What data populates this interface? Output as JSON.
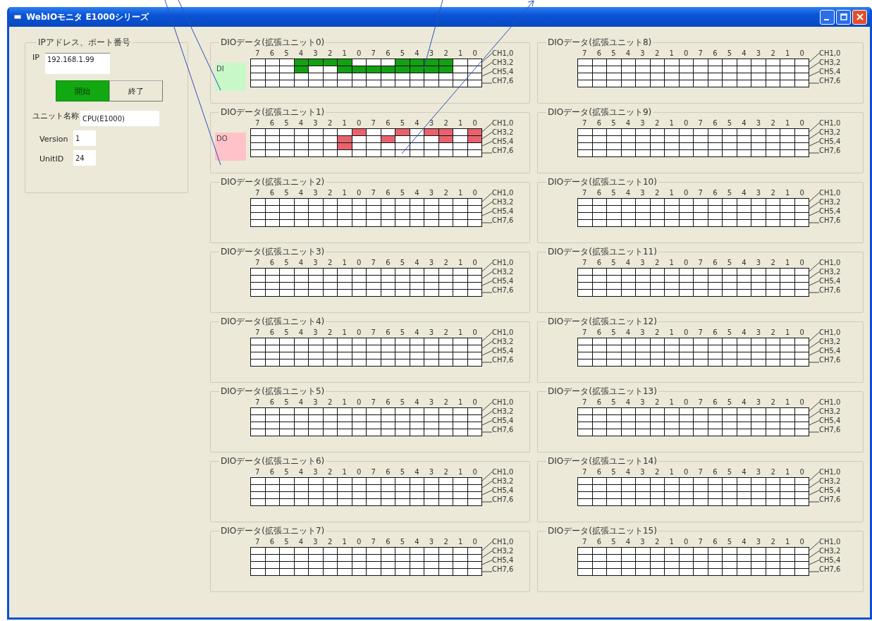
{
  "window": {
    "title": "WebIOモニタ E1000シリーズ"
  },
  "connection": {
    "title": "IPアドレス、ポート番号",
    "ip_label": "IP",
    "ip": "192.168.1.99",
    "buttons": [
      {
        "label": "開始",
        "on": true
      },
      {
        "label": "終了",
        "on": false
      }
    ],
    "unit_name_label": "ユニット名称",
    "unit_name": "CPU(E1000)",
    "version_label": "Version",
    "version": "1",
    "unitid_label": "UnitID",
    "unitid": "24"
  },
  "units": [
    {
      "title": "DIOデータ(拡張ユニット0)",
      "kind": "input",
      "indicator": "DI",
      "bits": [
        "7",
        "6",
        "5",
        "4",
        "3",
        "2",
        "1",
        "0",
        "7",
        "6",
        "5",
        "4",
        "3",
        "2",
        "1",
        "0"
      ],
      "rows": [
        {
          "label": "CH1,0",
          "cells": [
            false,
            false,
            false,
            true,
            true,
            true,
            true,
            false,
            false,
            false,
            true,
            true,
            true,
            true,
            false,
            false
          ]
        },
        {
          "label": "CH3,2",
          "cells": [
            false,
            false,
            false,
            true,
            false,
            false,
            true,
            true,
            true,
            true,
            true,
            true,
            true,
            true,
            false,
            false
          ]
        },
        {
          "label": "CH5,4",
          "cells": [
            false,
            false,
            false,
            false,
            false,
            false,
            false,
            false,
            false,
            false,
            false,
            false,
            false,
            false,
            false,
            false
          ]
        },
        {
          "label": "CH7,6",
          "cells": [
            false,
            false,
            false,
            false,
            false,
            false,
            false,
            false,
            false,
            false,
            false,
            false,
            false,
            false,
            false,
            false
          ]
        }
      ]
    },
    {
      "title": "DIOデータ(拡張ユニット1)",
      "kind": "output",
      "indicator": "DO",
      "bits": [
        "7",
        "6",
        "5",
        "4",
        "3",
        "2",
        "1",
        "0",
        "7",
        "6",
        "5",
        "4",
        "3",
        "2",
        "1",
        "0"
      ],
      "rows": [
        {
          "label": "CH1,0",
          "cells": [
            false,
            false,
            false,
            false,
            false,
            false,
            false,
            true,
            false,
            false,
            true,
            false,
            true,
            true,
            false,
            true
          ]
        },
        {
          "label": "CH3,2",
          "cells": [
            false,
            false,
            false,
            false,
            false,
            false,
            true,
            false,
            false,
            true,
            false,
            false,
            false,
            true,
            false,
            true
          ]
        },
        {
          "label": "CH5,4",
          "cells": [
            false,
            false,
            false,
            false,
            false,
            false,
            true,
            false,
            false,
            false,
            false,
            false,
            false,
            false,
            false,
            false
          ]
        },
        {
          "label": "CH7,6",
          "cells": [
            false,
            false,
            false,
            false,
            false,
            false,
            false,
            false,
            false,
            false,
            false,
            false,
            false,
            false,
            false,
            false
          ]
        }
      ]
    },
    {
      "title": "DIOデータ(拡張ユニット2)",
      "kind": "none",
      "bits": [
        "7",
        "6",
        "5",
        "4",
        "3",
        "2",
        "1",
        "0",
        "7",
        "6",
        "5",
        "4",
        "3",
        "2",
        "1",
        "0"
      ],
      "rows": [
        {
          "label": "CH1,0",
          "cells": [
            false,
            false,
            false,
            false,
            false,
            false,
            false,
            false,
            false,
            false,
            false,
            false,
            false,
            false,
            false,
            false
          ]
        },
        {
          "label": "CH3,2",
          "cells": [
            false,
            false,
            false,
            false,
            false,
            false,
            false,
            false,
            false,
            false,
            false,
            false,
            false,
            false,
            false,
            false
          ]
        },
        {
          "label": "CH5,4",
          "cells": [
            false,
            false,
            false,
            false,
            false,
            false,
            false,
            false,
            false,
            false,
            false,
            false,
            false,
            false,
            false,
            false
          ]
        },
        {
          "label": "CH7,6",
          "cells": [
            false,
            false,
            false,
            false,
            false,
            false,
            false,
            false,
            false,
            false,
            false,
            false,
            false,
            false,
            false,
            false
          ]
        }
      ]
    },
    {
      "title": "DIOデータ(拡張ユニット3)",
      "kind": "none",
      "bits": [
        "7",
        "6",
        "5",
        "4",
        "3",
        "2",
        "1",
        "0",
        "7",
        "6",
        "5",
        "4",
        "3",
        "2",
        "1",
        "0"
      ],
      "rows": [
        {
          "label": "CH1,0",
          "cells": [
            false,
            false,
            false,
            false,
            false,
            false,
            false,
            false,
            false,
            false,
            false,
            false,
            false,
            false,
            false,
            false
          ]
        },
        {
          "label": "CH3,2",
          "cells": [
            false,
            false,
            false,
            false,
            false,
            false,
            false,
            false,
            false,
            false,
            false,
            false,
            false,
            false,
            false,
            false
          ]
        },
        {
          "label": "CH5,4",
          "cells": [
            false,
            false,
            false,
            false,
            false,
            false,
            false,
            false,
            false,
            false,
            false,
            false,
            false,
            false,
            false,
            false
          ]
        },
        {
          "label": "CH7,6",
          "cells": [
            false,
            false,
            false,
            false,
            false,
            false,
            false,
            false,
            false,
            false,
            false,
            false,
            false,
            false,
            false,
            false
          ]
        }
      ]
    },
    {
      "title": "DIOデータ(拡張ユニット4)",
      "kind": "none",
      "bits": [
        "7",
        "6",
        "5",
        "4",
        "3",
        "2",
        "1",
        "0",
        "7",
        "6",
        "5",
        "4",
        "3",
        "2",
        "1",
        "0"
      ],
      "rows": [
        {
          "label": "CH1,0",
          "cells": [
            false,
            false,
            false,
            false,
            false,
            false,
            false,
            false,
            false,
            false,
            false,
            false,
            false,
            false,
            false,
            false
          ]
        },
        {
          "label": "CH3,2",
          "cells": [
            false,
            false,
            false,
            false,
            false,
            false,
            false,
            false,
            false,
            false,
            false,
            false,
            false,
            false,
            false,
            false
          ]
        },
        {
          "label": "CH5,4",
          "cells": [
            false,
            false,
            false,
            false,
            false,
            false,
            false,
            false,
            false,
            false,
            false,
            false,
            false,
            false,
            false,
            false
          ]
        },
        {
          "label": "CH7,6",
          "cells": [
            false,
            false,
            false,
            false,
            false,
            false,
            false,
            false,
            false,
            false,
            false,
            false,
            false,
            false,
            false,
            false
          ]
        }
      ]
    },
    {
      "title": "DIOデータ(拡張ユニット5)",
      "kind": "none",
      "bits": [
        "7",
        "6",
        "5",
        "4",
        "3",
        "2",
        "1",
        "0",
        "7",
        "6",
        "5",
        "4",
        "3",
        "2",
        "1",
        "0"
      ],
      "rows": [
        {
          "label": "CH1,0",
          "cells": [
            false,
            false,
            false,
            false,
            false,
            false,
            false,
            false,
            false,
            false,
            false,
            false,
            false,
            false,
            false,
            false
          ]
        },
        {
          "label": "CH3,2",
          "cells": [
            false,
            false,
            false,
            false,
            false,
            false,
            false,
            false,
            false,
            false,
            false,
            false,
            false,
            false,
            false,
            false
          ]
        },
        {
          "label": "CH5,4",
          "cells": [
            false,
            false,
            false,
            false,
            false,
            false,
            false,
            false,
            false,
            false,
            false,
            false,
            false,
            false,
            false,
            false
          ]
        },
        {
          "label": "CH7,6",
          "cells": [
            false,
            false,
            false,
            false,
            false,
            false,
            false,
            false,
            false,
            false,
            false,
            false,
            false,
            false,
            false,
            false
          ]
        }
      ]
    },
    {
      "title": "DIOデータ(拡張ユニット6)",
      "kind": "none",
      "bits": [
        "7",
        "6",
        "5",
        "4",
        "3",
        "2",
        "1",
        "0",
        "7",
        "6",
        "5",
        "4",
        "3",
        "2",
        "1",
        "0"
      ],
      "rows": [
        {
          "label": "CH1,0",
          "cells": [
            false,
            false,
            false,
            false,
            false,
            false,
            false,
            false,
            false,
            false,
            false,
            false,
            false,
            false,
            false,
            false
          ]
        },
        {
          "label": "CH3,2",
          "cells": [
            false,
            false,
            false,
            false,
            false,
            false,
            false,
            false,
            false,
            false,
            false,
            false,
            false,
            false,
            false,
            false
          ]
        },
        {
          "label": "CH5,4",
          "cells": [
            false,
            false,
            false,
            false,
            false,
            false,
            false,
            false,
            false,
            false,
            false,
            false,
            false,
            false,
            false,
            false
          ]
        },
        {
          "label": "CH7,6",
          "cells": [
            false,
            false,
            false,
            false,
            false,
            false,
            false,
            false,
            false,
            false,
            false,
            false,
            false,
            false,
            false,
            false
          ]
        }
      ]
    },
    {
      "title": "DIOデータ(拡張ユニット7)",
      "kind": "none",
      "bits": [
        "7",
        "6",
        "5",
        "4",
        "3",
        "2",
        "1",
        "0",
        "7",
        "6",
        "5",
        "4",
        "3",
        "2",
        "1",
        "0"
      ],
      "rows": [
        {
          "label": "CH1,0",
          "cells": [
            false,
            false,
            false,
            false,
            false,
            false,
            false,
            false,
            false,
            false,
            false,
            false,
            false,
            false,
            false,
            false
          ]
        },
        {
          "label": "CH3,2",
          "cells": [
            false,
            false,
            false,
            false,
            false,
            false,
            false,
            false,
            false,
            false,
            false,
            false,
            false,
            false,
            false,
            false
          ]
        },
        {
          "label": "CH5,4",
          "cells": [
            false,
            false,
            false,
            false,
            false,
            false,
            false,
            false,
            false,
            false,
            false,
            false,
            false,
            false,
            false,
            false
          ]
        },
        {
          "label": "CH7,6",
          "cells": [
            false,
            false,
            false,
            false,
            false,
            false,
            false,
            false,
            false,
            false,
            false,
            false,
            false,
            false,
            false,
            false
          ]
        }
      ]
    },
    {
      "title": "DIOデータ(拡張ユニット8)",
      "kind": "none",
      "bits": [
        "7",
        "6",
        "5",
        "4",
        "3",
        "2",
        "1",
        "0",
        "7",
        "6",
        "5",
        "4",
        "3",
        "2",
        "1",
        "0"
      ],
      "rows": [
        {
          "label": "CH1,0",
          "cells": [
            false,
            false,
            false,
            false,
            false,
            false,
            false,
            false,
            false,
            false,
            false,
            false,
            false,
            false,
            false,
            false
          ]
        },
        {
          "label": "CH3,2",
          "cells": [
            false,
            false,
            false,
            false,
            false,
            false,
            false,
            false,
            false,
            false,
            false,
            false,
            false,
            false,
            false,
            false
          ]
        },
        {
          "label": "CH5,4",
          "cells": [
            false,
            false,
            false,
            false,
            false,
            false,
            false,
            false,
            false,
            false,
            false,
            false,
            false,
            false,
            false,
            false
          ]
        },
        {
          "label": "CH7,6",
          "cells": [
            false,
            false,
            false,
            false,
            false,
            false,
            false,
            false,
            false,
            false,
            false,
            false,
            false,
            false,
            false,
            false
          ]
        }
      ]
    },
    {
      "title": "DIOデータ(拡張ユニット9)",
      "kind": "none",
      "bits": [
        "7",
        "6",
        "5",
        "4",
        "3",
        "2",
        "1",
        "0",
        "7",
        "6",
        "5",
        "4",
        "3",
        "2",
        "1",
        "0"
      ],
      "rows": [
        {
          "label": "CH1,0",
          "cells": [
            false,
            false,
            false,
            false,
            false,
            false,
            false,
            false,
            false,
            false,
            false,
            false,
            false,
            false,
            false,
            false
          ]
        },
        {
          "label": "CH3,2",
          "cells": [
            false,
            false,
            false,
            false,
            false,
            false,
            false,
            false,
            false,
            false,
            false,
            false,
            false,
            false,
            false,
            false
          ]
        },
        {
          "label": "CH5,4",
          "cells": [
            false,
            false,
            false,
            false,
            false,
            false,
            false,
            false,
            false,
            false,
            false,
            false,
            false,
            false,
            false,
            false
          ]
        },
        {
          "label": "CH7,6",
          "cells": [
            false,
            false,
            false,
            false,
            false,
            false,
            false,
            false,
            false,
            false,
            false,
            false,
            false,
            false,
            false,
            false
          ]
        }
      ]
    },
    {
      "title": "DIOデータ(拡張ユニット10)",
      "kind": "none",
      "bits": [
        "7",
        "6",
        "5",
        "4",
        "3",
        "2",
        "1",
        "0",
        "7",
        "6",
        "5",
        "4",
        "3",
        "2",
        "1",
        "0"
      ],
      "rows": [
        {
          "label": "CH1,0",
          "cells": [
            false,
            false,
            false,
            false,
            false,
            false,
            false,
            false,
            false,
            false,
            false,
            false,
            false,
            false,
            false,
            false
          ]
        },
        {
          "label": "CH3,2",
          "cells": [
            false,
            false,
            false,
            false,
            false,
            false,
            false,
            false,
            false,
            false,
            false,
            false,
            false,
            false,
            false,
            false
          ]
        },
        {
          "label": "CH5,4",
          "cells": [
            false,
            false,
            false,
            false,
            false,
            false,
            false,
            false,
            false,
            false,
            false,
            false,
            false,
            false,
            false,
            false
          ]
        },
        {
          "label": "CH7,6",
          "cells": [
            false,
            false,
            false,
            false,
            false,
            false,
            false,
            false,
            false,
            false,
            false,
            false,
            false,
            false,
            false,
            false
          ]
        }
      ]
    },
    {
      "title": "DIOデータ(拡張ユニット11)",
      "kind": "none",
      "bits": [
        "7",
        "6",
        "5",
        "4",
        "3",
        "2",
        "1",
        "0",
        "7",
        "6",
        "5",
        "4",
        "3",
        "2",
        "1",
        "0"
      ],
      "rows": [
        {
          "label": "CH1,0",
          "cells": [
            false,
            false,
            false,
            false,
            false,
            false,
            false,
            false,
            false,
            false,
            false,
            false,
            false,
            false,
            false,
            false
          ]
        },
        {
          "label": "CH3,2",
          "cells": [
            false,
            false,
            false,
            false,
            false,
            false,
            false,
            false,
            false,
            false,
            false,
            false,
            false,
            false,
            false,
            false
          ]
        },
        {
          "label": "CH5,4",
          "cells": [
            false,
            false,
            false,
            false,
            false,
            false,
            false,
            false,
            false,
            false,
            false,
            false,
            false,
            false,
            false,
            false
          ]
        },
        {
          "label": "CH7,6",
          "cells": [
            false,
            false,
            false,
            false,
            false,
            false,
            false,
            false,
            false,
            false,
            false,
            false,
            false,
            false,
            false,
            false
          ]
        }
      ]
    },
    {
      "title": "DIOデータ(拡張ユニット12)",
      "kind": "none",
      "bits": [
        "7",
        "6",
        "5",
        "4",
        "3",
        "2",
        "1",
        "0",
        "7",
        "6",
        "5",
        "4",
        "3",
        "2",
        "1",
        "0"
      ],
      "rows": [
        {
          "label": "CH1,0",
          "cells": [
            false,
            false,
            false,
            false,
            false,
            false,
            false,
            false,
            false,
            false,
            false,
            false,
            false,
            false,
            false,
            false
          ]
        },
        {
          "label": "CH3,2",
          "cells": [
            false,
            false,
            false,
            false,
            false,
            false,
            false,
            false,
            false,
            false,
            false,
            false,
            false,
            false,
            false,
            false
          ]
        },
        {
          "label": "CH5,4",
          "cells": [
            false,
            false,
            false,
            false,
            false,
            false,
            false,
            false,
            false,
            false,
            false,
            false,
            false,
            false,
            false,
            false
          ]
        },
        {
          "label": "CH7,6",
          "cells": [
            false,
            false,
            false,
            false,
            false,
            false,
            false,
            false,
            false,
            false,
            false,
            false,
            false,
            false,
            false,
            false
          ]
        }
      ]
    },
    {
      "title": "DIOデータ(拡張ユニット13)",
      "kind": "none",
      "bits": [
        "7",
        "6",
        "5",
        "4",
        "3",
        "2",
        "1",
        "0",
        "7",
        "6",
        "5",
        "4",
        "3",
        "2",
        "1",
        "0"
      ],
      "rows": [
        {
          "label": "CH1,0",
          "cells": [
            false,
            false,
            false,
            false,
            false,
            false,
            false,
            false,
            false,
            false,
            false,
            false,
            false,
            false,
            false,
            false
          ]
        },
        {
          "label": "CH3,2",
          "cells": [
            false,
            false,
            false,
            false,
            false,
            false,
            false,
            false,
            false,
            false,
            false,
            false,
            false,
            false,
            false,
            false
          ]
        },
        {
          "label": "CH5,4",
          "cells": [
            false,
            false,
            false,
            false,
            false,
            false,
            false,
            false,
            false,
            false,
            false,
            false,
            false,
            false,
            false,
            false
          ]
        },
        {
          "label": "CH7,6",
          "cells": [
            false,
            false,
            false,
            false,
            false,
            false,
            false,
            false,
            false,
            false,
            false,
            false,
            false,
            false,
            false,
            false
          ]
        }
      ]
    },
    {
      "title": "DIOデータ(拡張ユニット14)",
      "kind": "none",
      "bits": [
        "7",
        "6",
        "5",
        "4",
        "3",
        "2",
        "1",
        "0",
        "7",
        "6",
        "5",
        "4",
        "3",
        "2",
        "1",
        "0"
      ],
      "rows": [
        {
          "label": "CH1,0",
          "cells": [
            false,
            false,
            false,
            false,
            false,
            false,
            false,
            false,
            false,
            false,
            false,
            false,
            false,
            false,
            false,
            false
          ]
        },
        {
          "label": "CH3,2",
          "cells": [
            false,
            false,
            false,
            false,
            false,
            false,
            false,
            false,
            false,
            false,
            false,
            false,
            false,
            false,
            false,
            false
          ]
        },
        {
          "label": "CH5,4",
          "cells": [
            false,
            false,
            false,
            false,
            false,
            false,
            false,
            false,
            false,
            false,
            false,
            false,
            false,
            false,
            false,
            false
          ]
        },
        {
          "label": "CH7,6",
          "cells": [
            false,
            false,
            false,
            false,
            false,
            false,
            false,
            false,
            false,
            false,
            false,
            false,
            false,
            false,
            false,
            false
          ]
        }
      ]
    },
    {
      "title": "DIOデータ(拡張ユニット15)",
      "kind": "none",
      "bits": [
        "7",
        "6",
        "5",
        "4",
        "3",
        "2",
        "1",
        "0",
        "7",
        "6",
        "5",
        "4",
        "3",
        "2",
        "1",
        "0"
      ],
      "rows": [
        {
          "label": "CH1,0",
          "cells": [
            false,
            false,
            false,
            false,
            false,
            false,
            false,
            false,
            false,
            false,
            false,
            false,
            false,
            false,
            false,
            false
          ]
        },
        {
          "label": "CH3,2",
          "cells": [
            false,
            false,
            false,
            false,
            false,
            false,
            false,
            false,
            false,
            false,
            false,
            false,
            false,
            false,
            false,
            false
          ]
        },
        {
          "label": "CH5,4",
          "cells": [
            false,
            false,
            false,
            false,
            false,
            false,
            false,
            false,
            false,
            false,
            false,
            false,
            false,
            false,
            false,
            false
          ]
        },
        {
          "label": "CH7,6",
          "cells": [
            false,
            false,
            false,
            false,
            false,
            false,
            false,
            false,
            false,
            false,
            false,
            false,
            false,
            false,
            false,
            false
          ]
        }
      ]
    }
  ]
}
